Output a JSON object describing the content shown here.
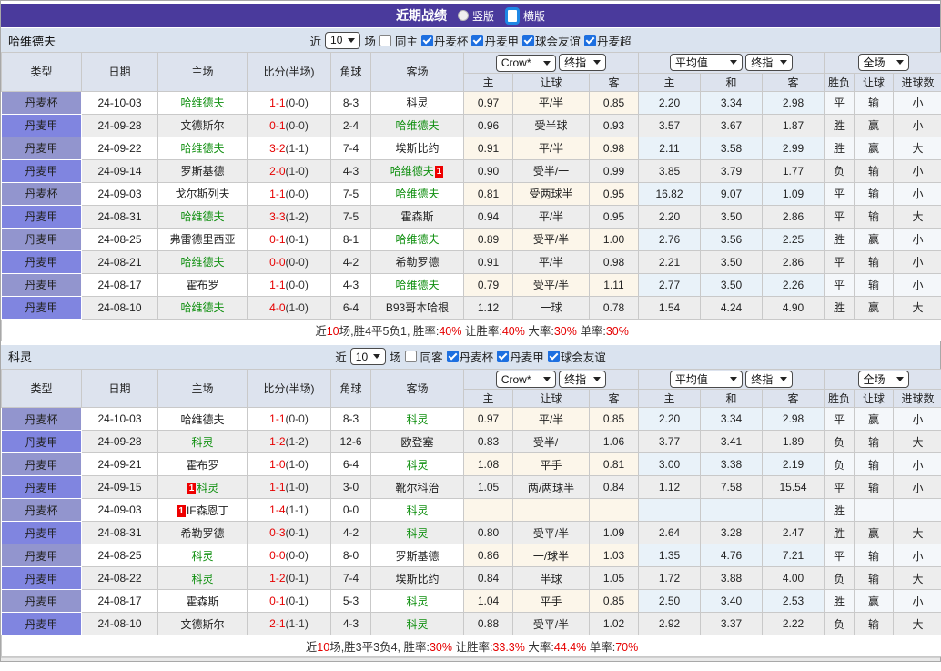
{
  "title_bar": {
    "title": "近期战绩",
    "vertical_label": "竖版",
    "horizontal_label": "横版",
    "selected": "横版"
  },
  "colors": {
    "title_bar_bg": "#4a3a9c",
    "accent_blue": "#1d6fe0",
    "league_cell_odd": "#9295ce",
    "league_cell_even": "#8085e0",
    "highlight_team_green": "#0f8f0f",
    "score_red": "#e60000",
    "win_red": "#d60000",
    "lose_blue": "#2a2ad0",
    "draw_green": "#0f8f0f",
    "header_bg": "#dde3ee",
    "filter_bg": "#dae3ef",
    "stripe_gray": "#ededed",
    "handicap_col_bg": "#fcf6ea",
    "avg_col_bg": "#e9f2f9"
  },
  "header": {
    "type": "类型",
    "date": "日期",
    "home": "主场",
    "score": "比分(半场)",
    "corner": "角球",
    "away": "客场",
    "crow_select": "Crow*",
    "final_select": "终指",
    "avg_select": "平均值",
    "fulltime_select": "全场",
    "sub": {
      "home": "主",
      "handicap": "让球",
      "away": "客",
      "avg_home": "主",
      "avg_draw": "和",
      "avg_away": "客",
      "result": "胜负",
      "handicap_result": "让球",
      "goals": "进球数"
    }
  },
  "sections": [
    {
      "team": "哈维德夫",
      "filter": {
        "near": "近",
        "count": "10",
        "games": "场",
        "same": "同主",
        "same_checked": false,
        "leagues": [
          {
            "label": "丹麦杯",
            "checked": true
          },
          {
            "label": "丹麦甲",
            "checked": true
          },
          {
            "label": "球会友谊",
            "checked": true
          },
          {
            "label": "丹麦超",
            "checked": true
          }
        ]
      },
      "rows": [
        {
          "lg": "丹麦杯",
          "dt": "24-10-03",
          "home": {
            "n": "哈维德夫",
            "hl": true
          },
          "score": "1-1",
          "half": "(0-0)",
          "cor": "8-3",
          "away": {
            "n": "科灵"
          },
          "crow": [
            "0.97",
            "平/半",
            "0.85"
          ],
          "avg": [
            "2.20",
            "3.34",
            "2.98"
          ],
          "res": {
            "t": "平",
            "c": "g"
          },
          "hres": {
            "t": "输",
            "c": "b"
          },
          "goal": {
            "t": "小",
            "c": "b"
          }
        },
        {
          "lg": "丹麦甲",
          "dt": "24-09-28",
          "home": {
            "n": "文德斯尔"
          },
          "score": "0-1",
          "half": "(0-0)",
          "cor": "2-4",
          "away": {
            "n": "哈维德夫",
            "hl": true
          },
          "crow": [
            "0.96",
            "受半球",
            "0.93"
          ],
          "avg": [
            "3.57",
            "3.67",
            "1.87"
          ],
          "res": {
            "t": "胜",
            "c": "r"
          },
          "hres": {
            "t": "赢",
            "c": "r"
          },
          "goal": {
            "t": "小",
            "c": "b"
          }
        },
        {
          "lg": "丹麦甲",
          "dt": "24-09-22",
          "home": {
            "n": "哈维德夫",
            "hl": true
          },
          "score": "3-2",
          "half": "(1-1)",
          "cor": "7-4",
          "away": {
            "n": "埃斯比约"
          },
          "crow": [
            "0.91",
            "平/半",
            "0.98"
          ],
          "avg": [
            "2.11",
            "3.58",
            "2.99"
          ],
          "res": {
            "t": "胜",
            "c": "r"
          },
          "hres": {
            "t": "赢",
            "c": "r"
          },
          "goal": {
            "t": "大",
            "c": "r"
          }
        },
        {
          "lg": "丹麦甲",
          "dt": "24-09-14",
          "home": {
            "n": "罗斯基德"
          },
          "score": "2-0",
          "half": "(1-0)",
          "cor": "4-3",
          "away": {
            "n": "哈维德夫",
            "hl": true,
            "badge": "1",
            "bpos": "after"
          },
          "crow": [
            "0.90",
            "受半/一",
            "0.99"
          ],
          "avg": [
            "3.85",
            "3.79",
            "1.77"
          ],
          "res": {
            "t": "负",
            "c": "b"
          },
          "hres": {
            "t": "输",
            "c": "b"
          },
          "goal": {
            "t": "小",
            "c": "b"
          }
        },
        {
          "lg": "丹麦杯",
          "dt": "24-09-03",
          "home": {
            "n": "戈尔斯列夫"
          },
          "score": "1-1",
          "half": "(0-0)",
          "cor": "7-5",
          "away": {
            "n": "哈维德夫",
            "hl": true
          },
          "crow": [
            "0.81",
            "受两球半",
            "0.95"
          ],
          "avg": [
            "16.82",
            "9.07",
            "1.09"
          ],
          "res": {
            "t": "平",
            "c": "g"
          },
          "hres": {
            "t": "输",
            "c": "b"
          },
          "goal": {
            "t": "小",
            "c": "b"
          }
        },
        {
          "lg": "丹麦甲",
          "dt": "24-08-31",
          "home": {
            "n": "哈维德夫",
            "hl": true
          },
          "score": "3-3",
          "half": "(1-2)",
          "cor": "7-5",
          "away": {
            "n": "霍森斯"
          },
          "crow": [
            "0.94",
            "平/半",
            "0.95"
          ],
          "avg": [
            "2.20",
            "3.50",
            "2.86"
          ],
          "res": {
            "t": "平",
            "c": "g"
          },
          "hres": {
            "t": "输",
            "c": "b"
          },
          "goal": {
            "t": "大",
            "c": "r"
          }
        },
        {
          "lg": "丹麦甲",
          "dt": "24-08-25",
          "home": {
            "n": "弗雷德里西亚"
          },
          "score": "0-1",
          "half": "(0-1)",
          "cor": "8-1",
          "away": {
            "n": "哈维德夫",
            "hl": true
          },
          "crow": [
            "0.89",
            "受平/半",
            "1.00"
          ],
          "avg": [
            "2.76",
            "3.56",
            "2.25"
          ],
          "res": {
            "t": "胜",
            "c": "r"
          },
          "hres": {
            "t": "赢",
            "c": "r"
          },
          "goal": {
            "t": "小",
            "c": "b"
          }
        },
        {
          "lg": "丹麦甲",
          "dt": "24-08-21",
          "home": {
            "n": "哈维德夫",
            "hl": true
          },
          "score": "0-0",
          "half": "(0-0)",
          "cor": "4-2",
          "away": {
            "n": "希勒罗德"
          },
          "crow": [
            "0.91",
            "平/半",
            "0.98"
          ],
          "avg": [
            "2.21",
            "3.50",
            "2.86"
          ],
          "res": {
            "t": "平",
            "c": "g"
          },
          "hres": {
            "t": "输",
            "c": "b"
          },
          "goal": {
            "t": "小",
            "c": "b"
          }
        },
        {
          "lg": "丹麦甲",
          "dt": "24-08-17",
          "home": {
            "n": "霍布罗"
          },
          "score": "1-1",
          "half": "(0-0)",
          "cor": "4-3",
          "away": {
            "n": "哈维德夫",
            "hl": true
          },
          "crow": [
            "0.79",
            "受平/半",
            "1.11"
          ],
          "avg": [
            "2.77",
            "3.50",
            "2.26"
          ],
          "res": {
            "t": "平",
            "c": "g"
          },
          "hres": {
            "t": "输",
            "c": "b"
          },
          "goal": {
            "t": "小",
            "c": "b"
          }
        },
        {
          "lg": "丹麦甲",
          "dt": "24-08-10",
          "home": {
            "n": "哈维德夫",
            "hl": true
          },
          "score": "4-0",
          "half": "(1-0)",
          "cor": "6-4",
          "away": {
            "n": "B93哥本哈根"
          },
          "crow": [
            "1.12",
            "一球",
            "0.78"
          ],
          "avg": [
            "1.54",
            "4.24",
            "4.90"
          ],
          "res": {
            "t": "胜",
            "c": "r"
          },
          "hres": {
            "t": "赢",
            "c": "r"
          },
          "goal": {
            "t": "大",
            "c": "r"
          }
        }
      ],
      "summary": [
        {
          "t": "近"
        },
        {
          "t": "10",
          "r": 1
        },
        {
          "t": "场,胜4平5负1, 胜率:"
        },
        {
          "t": "40%",
          "r": 1
        },
        {
          "t": " 让胜率:"
        },
        {
          "t": "40%",
          "r": 1
        },
        {
          "t": " 大率:"
        },
        {
          "t": "30%",
          "r": 1
        },
        {
          "t": " 单率:"
        },
        {
          "t": "30%",
          "r": 1
        }
      ]
    },
    {
      "team": "科灵",
      "filter": {
        "near": "近",
        "count": "10",
        "games": "场",
        "same": "同客",
        "same_checked": false,
        "leagues": [
          {
            "label": "丹麦杯",
            "checked": true
          },
          {
            "label": "丹麦甲",
            "checked": true
          },
          {
            "label": "球会友谊",
            "checked": true
          }
        ]
      },
      "rows": [
        {
          "lg": "丹麦杯",
          "dt": "24-10-03",
          "home": {
            "n": "哈维德夫"
          },
          "score": "1-1",
          "half": "(0-0)",
          "cor": "8-3",
          "away": {
            "n": "科灵",
            "hl": true
          },
          "crow": [
            "0.97",
            "平/半",
            "0.85"
          ],
          "avg": [
            "2.20",
            "3.34",
            "2.98"
          ],
          "res": {
            "t": "平",
            "c": "g"
          },
          "hres": {
            "t": "赢",
            "c": "r"
          },
          "goal": {
            "t": "小",
            "c": "b"
          }
        },
        {
          "lg": "丹麦甲",
          "dt": "24-09-28",
          "home": {
            "n": "科灵",
            "hl": true
          },
          "score": "1-2",
          "half": "(1-2)",
          "cor": "12-6",
          "away": {
            "n": "欧登塞"
          },
          "crow": [
            "0.83",
            "受半/一",
            "1.06"
          ],
          "avg": [
            "3.77",
            "3.41",
            "1.89"
          ],
          "res": {
            "t": "负",
            "c": "b"
          },
          "hres": {
            "t": "输",
            "c": "b"
          },
          "goal": {
            "t": "大",
            "c": "r"
          }
        },
        {
          "lg": "丹麦甲",
          "dt": "24-09-21",
          "home": {
            "n": "霍布罗"
          },
          "score": "1-0",
          "half": "(1-0)",
          "cor": "6-4",
          "away": {
            "n": "科灵",
            "hl": true
          },
          "crow": [
            "1.08",
            "平手",
            "0.81"
          ],
          "avg": [
            "3.00",
            "3.38",
            "2.19"
          ],
          "res": {
            "t": "负",
            "c": "b"
          },
          "hres": {
            "t": "输",
            "c": "b"
          },
          "goal": {
            "t": "小",
            "c": "b"
          }
        },
        {
          "lg": "丹麦甲",
          "dt": "24-09-15",
          "home": {
            "n": "科灵",
            "hl": true,
            "badge": "1",
            "bpos": "before"
          },
          "score": "1-1",
          "half": "(1-0)",
          "cor": "3-0",
          "away": {
            "n": "靴尔科治"
          },
          "crow": [
            "1.05",
            "两/两球半",
            "0.84"
          ],
          "avg": [
            "1.12",
            "7.58",
            "15.54"
          ],
          "res": {
            "t": "平",
            "c": "g"
          },
          "hres": {
            "t": "输",
            "c": "b"
          },
          "goal": {
            "t": "小",
            "c": "b"
          }
        },
        {
          "lg": "丹麦杯",
          "dt": "24-09-03",
          "home": {
            "n": "IF森恩丁",
            "badge": "1",
            "bpos": "before"
          },
          "score": "1-4",
          "half": "(1-1)",
          "cor": "0-0",
          "away": {
            "n": "科灵",
            "hl": true
          },
          "crow": [
            "",
            "",
            ""
          ],
          "avg": [
            "",
            "",
            ""
          ],
          "res": {
            "t": "胜",
            "c": "r"
          },
          "hres": {
            "t": "",
            "c": ""
          },
          "goal": {
            "t": "",
            "c": ""
          }
        },
        {
          "lg": "丹麦甲",
          "dt": "24-08-31",
          "home": {
            "n": "希勒罗德"
          },
          "score": "0-3",
          "half": "(0-1)",
          "cor": "4-2",
          "away": {
            "n": "科灵",
            "hl": true
          },
          "crow": [
            "0.80",
            "受平/半",
            "1.09"
          ],
          "avg": [
            "2.64",
            "3.28",
            "2.47"
          ],
          "res": {
            "t": "胜",
            "c": "r"
          },
          "hres": {
            "t": "赢",
            "c": "r"
          },
          "goal": {
            "t": "大",
            "c": "r"
          }
        },
        {
          "lg": "丹麦甲",
          "dt": "24-08-25",
          "home": {
            "n": "科灵",
            "hl": true
          },
          "score": "0-0",
          "half": "(0-0)",
          "cor": "8-0",
          "away": {
            "n": "罗斯基德"
          },
          "crow": [
            "0.86",
            "一/球半",
            "1.03"
          ],
          "avg": [
            "1.35",
            "4.76",
            "7.21"
          ],
          "res": {
            "t": "平",
            "c": "g"
          },
          "hres": {
            "t": "输",
            "c": "b"
          },
          "goal": {
            "t": "小",
            "c": "b"
          }
        },
        {
          "lg": "丹麦甲",
          "dt": "24-08-22",
          "home": {
            "n": "科灵",
            "hl": true
          },
          "score": "1-2",
          "half": "(0-1)",
          "cor": "7-4",
          "away": {
            "n": "埃斯比约"
          },
          "crow": [
            "0.84",
            "半球",
            "1.05"
          ],
          "avg": [
            "1.72",
            "3.88",
            "4.00"
          ],
          "res": {
            "t": "负",
            "c": "b"
          },
          "hres": {
            "t": "输",
            "c": "b"
          },
          "goal": {
            "t": "大",
            "c": "r"
          }
        },
        {
          "lg": "丹麦甲",
          "dt": "24-08-17",
          "home": {
            "n": "霍森斯"
          },
          "score": "0-1",
          "half": "(0-1)",
          "cor": "5-3",
          "away": {
            "n": "科灵",
            "hl": true
          },
          "crow": [
            "1.04",
            "平手",
            "0.85"
          ],
          "avg": [
            "2.50",
            "3.40",
            "2.53"
          ],
          "res": {
            "t": "胜",
            "c": "r"
          },
          "hres": {
            "t": "赢",
            "c": "r"
          },
          "goal": {
            "t": "小",
            "c": "b"
          }
        },
        {
          "lg": "丹麦甲",
          "dt": "24-08-10",
          "home": {
            "n": "文德斯尔"
          },
          "score": "2-1",
          "half": "(1-1)",
          "cor": "4-3",
          "away": {
            "n": "科灵",
            "hl": true
          },
          "crow": [
            "0.88",
            "受平/半",
            "1.02"
          ],
          "avg": [
            "2.92",
            "3.37",
            "2.22"
          ],
          "res": {
            "t": "负",
            "c": "b"
          },
          "hres": {
            "t": "输",
            "c": "b"
          },
          "goal": {
            "t": "大",
            "c": "r"
          }
        }
      ],
      "summary": [
        {
          "t": "近"
        },
        {
          "t": "10",
          "r": 1
        },
        {
          "t": "场,胜3平3负4, 胜率:"
        },
        {
          "t": "30%",
          "r": 1
        },
        {
          "t": " 让胜率:"
        },
        {
          "t": "33.3%",
          "r": 1
        },
        {
          "t": " 大率:"
        },
        {
          "t": "44.4%",
          "r": 1
        },
        {
          "t": " 单率:"
        },
        {
          "t": "70%",
          "r": 1
        }
      ]
    }
  ]
}
